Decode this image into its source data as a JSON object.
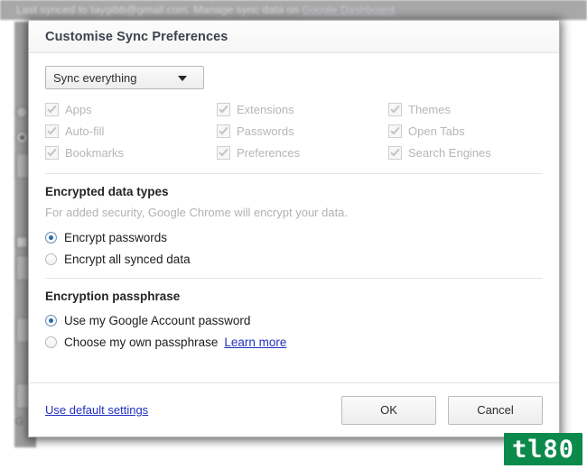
{
  "background": {
    "status_text_prefix": "Last synced to taygibb@gmail.com. Manage sync data on ",
    "status_link": "Google Dashboard",
    "status_text_suffix": ".",
    "bottom_text": "G"
  },
  "dialog": {
    "title": "Customise Sync Preferences",
    "sync_select": {
      "value": "Sync everything",
      "caret_icon": "chevron-down-icon"
    },
    "data_types": [
      {
        "label": "Apps",
        "checked": true,
        "disabled": true
      },
      {
        "label": "Extensions",
        "checked": true,
        "disabled": true
      },
      {
        "label": "Themes",
        "checked": true,
        "disabled": true
      },
      {
        "label": "Auto-fill",
        "checked": true,
        "disabled": true
      },
      {
        "label": "Passwords",
        "checked": true,
        "disabled": true
      },
      {
        "label": "Open Tabs",
        "checked": true,
        "disabled": true
      },
      {
        "label": "Bookmarks",
        "checked": true,
        "disabled": true
      },
      {
        "label": "Preferences",
        "checked": true,
        "disabled": true
      },
      {
        "label": "Search Engines",
        "checked": true,
        "disabled": true
      }
    ],
    "encrypted_section": {
      "title": "Encrypted data types",
      "description": "For added security, Google Chrome will encrypt your data.",
      "options": [
        {
          "label": "Encrypt passwords",
          "selected": true
        },
        {
          "label": "Encrypt all synced data",
          "selected": false
        }
      ]
    },
    "passphrase_section": {
      "title": "Encryption passphrase",
      "options": [
        {
          "label": "Use my Google Account password",
          "selected": true
        },
        {
          "label": "Choose my own passphrase",
          "selected": false
        }
      ],
      "learn_more": "Learn more"
    },
    "footer": {
      "default_settings_link": "Use default settings",
      "ok_label": "OK",
      "cancel_label": "Cancel"
    }
  },
  "watermark": {
    "text": "tl80",
    "color": "#0b8a4b"
  }
}
